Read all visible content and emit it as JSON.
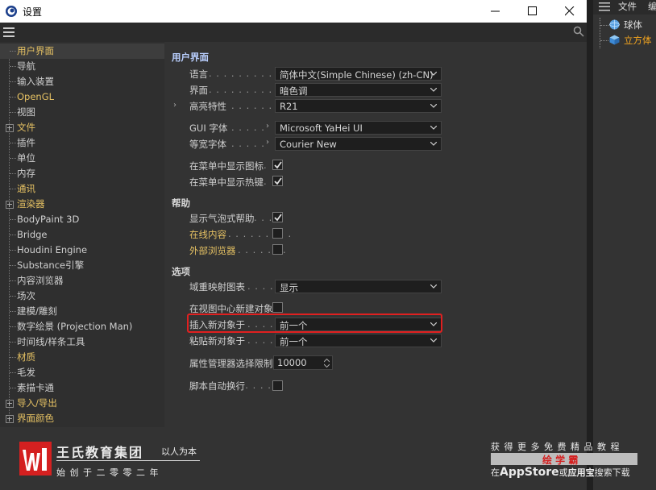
{
  "window": {
    "title": "设置",
    "controls": [
      "minimize",
      "maximize",
      "close"
    ]
  },
  "sidebar": {
    "items": [
      {
        "label": "用户界面",
        "color": "yellow",
        "selected": true
      },
      {
        "label": "导航",
        "color": "white"
      },
      {
        "label": "输入装置",
        "color": "white"
      },
      {
        "label": "OpenGL",
        "color": "yellow"
      },
      {
        "label": "视图",
        "color": "white"
      },
      {
        "label": "文件",
        "color": "yellow",
        "expandable": true
      },
      {
        "label": "插件",
        "color": "white"
      },
      {
        "label": "单位",
        "color": "white"
      },
      {
        "label": "内存",
        "color": "white"
      },
      {
        "label": "通讯",
        "color": "yellow"
      },
      {
        "label": "渲染器",
        "color": "yellow",
        "expandable": true
      },
      {
        "label": "BodyPaint 3D",
        "color": "white"
      },
      {
        "label": "Bridge",
        "color": "white"
      },
      {
        "label": "Houdini Engine",
        "color": "white"
      },
      {
        "label": "Substance引擎",
        "color": "white"
      },
      {
        "label": "内容浏览器",
        "color": "white"
      },
      {
        "label": "场次",
        "color": "white"
      },
      {
        "label": "建模/雕刻",
        "color": "white"
      },
      {
        "label": "数字绘景 (Projection Man)",
        "color": "white"
      },
      {
        "label": "时间线/样条工具",
        "color": "white"
      },
      {
        "label": "材质",
        "color": "yellow"
      },
      {
        "label": "毛发",
        "color": "white"
      },
      {
        "label": "素描卡通",
        "color": "white"
      },
      {
        "label": "导入/导出",
        "color": "yellow",
        "expandable": true
      },
      {
        "label": "界面颜色",
        "color": "yellow",
        "expandable": true
      }
    ]
  },
  "main": {
    "section_ui": "用户界面",
    "language_label": "语言",
    "language_value": "简体中文(Simple Chinese) (zh-CN)",
    "interface_label": "界面",
    "interface_value": "暗色调",
    "highlight_label": "高亮特性",
    "highlight_value": "R21",
    "gui_font_label": "GUI 字体",
    "gui_font_value": "Microsoft YaHei UI",
    "mono_font_label": "等宽字体",
    "mono_font_value": "Courier New",
    "show_icons_label": "在菜单中显示图标",
    "show_icons_checked": true,
    "show_hotkeys_label": "在菜单中显示热键",
    "show_hotkeys_checked": true,
    "section_help": "帮助",
    "bubble_help_label": "显示气泡式帮助",
    "bubble_help_checked": true,
    "online_content_label": "在线内容",
    "online_content_checked": false,
    "external_browser_label": "外部浏览器",
    "external_browser_checked": false,
    "section_options": "选项",
    "domain_map_label": "域重映射图表",
    "domain_map_value": "显示",
    "create_at_center_label": "在视图中心新建对象",
    "create_at_center_checked": false,
    "insert_new_label": "插入新对象于",
    "insert_new_value": "前一个",
    "paste_new_label": "粘贴新对象于",
    "paste_new_value": "前一个",
    "attr_limit_label": "属性管理器选择限制",
    "attr_limit_value": "10000",
    "script_wrap_label": "脚本自动换行",
    "script_wrap_checked": false
  },
  "right_panel": {
    "menu_file": "文件",
    "menu_edit": "编",
    "objects": [
      {
        "label": "球体",
        "color": "white",
        "icon": "sphere-icon"
      },
      {
        "label": "立方体",
        "color": "orange",
        "icon": "cube-icon"
      }
    ]
  },
  "watermark_left": {
    "org_name": "王氏教育集团",
    "motto": "以人为本",
    "tagline": "始 创 于 二 零 零 二 年"
  },
  "watermark_right": {
    "line1": "获 得 更 多 免 费 精 品 教 程",
    "brand": "绘 学 霸",
    "line3_prefix": "在",
    "line3_store": "AppStore",
    "line3_mid": "或",
    "line3_app": "应用宝",
    "line3_suffix": "搜索下载"
  },
  "colors": {
    "accent_yellow": "#e5c163",
    "highlight_box": "#e02020",
    "brand_red": "#d42020"
  }
}
